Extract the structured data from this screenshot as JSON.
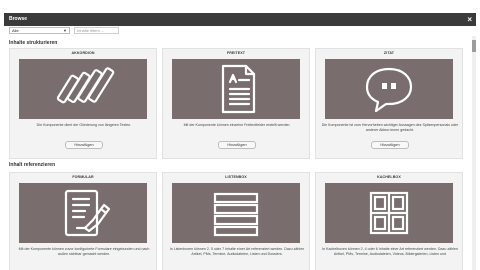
{
  "window": {
    "title": "Browse",
    "close": "×"
  },
  "filters": {
    "select_value": "Alle",
    "search_placeholder": "Inhalte filtern ..."
  },
  "sections": [
    {
      "title": "Inhalte strukturieren"
    },
    {
      "title": "Inhalt referenzieren"
    }
  ],
  "cards": [
    {
      "title": "AKKORDION",
      "desc": "Die Komponente dient der Gliederung von längeren Texten.",
      "button": "Hinzufügen",
      "icon": "accordion-icon"
    },
    {
      "title": "FREITEXT",
      "desc": "Mit der Komponente können einzelne Freitextfelder erstellt werden.",
      "button": "Hinzufügen",
      "icon": "document-icon"
    },
    {
      "title": "ZITAT",
      "desc": "Die Komponente ist zum Hervorheben wichtiger Aussagen des Spitzenpersonals oder anderer Akteur:innen gedacht.",
      "button": "Hinzufügen",
      "icon": "quote-icon"
    },
    {
      "title": "FORMULAR",
      "desc": "Mit der Komponente können zuvor konfigurierte Formulare eingebunden und nach außen sichtbar gemacht werden.",
      "icon": "form-icon"
    },
    {
      "title": "LISTENBOX",
      "desc": "In Listenboxen können 2, 5 oder 7 Inhalte einer Art referenziert werden. Dazu zählen Artikel, PMs, Termine, Audiodateien, Listen und Dossiers.",
      "icon": "list-icon"
    },
    {
      "title": "KACHELBOX",
      "desc": "In Kachelboxen können 2, 4 oder 6 Inhalte einer Art referenziert werden. Dazu zählen Artikel, PMs, Termine, Audiodateien, Videos, Bildergalerien, Listen und",
      "icon": "grid-icon"
    }
  ],
  "colors": {
    "titlebar": "#3a3a3a",
    "preview_bg": "#7a6d6d",
    "icon": "#ffffff"
  }
}
